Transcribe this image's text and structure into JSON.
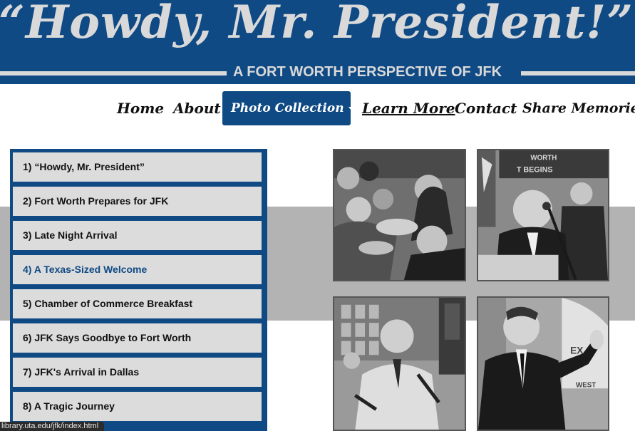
{
  "banner": {
    "title": "“Howdy, Mr. President!”",
    "subtitle": "A FORT WORTH PERSPECTIVE OF JFK"
  },
  "nav": {
    "items": [
      {
        "label": "Home"
      },
      {
        "label": "About"
      },
      {
        "label": "Photo Collection"
      },
      {
        "label": "Learn More"
      },
      {
        "label": "Contact"
      },
      {
        "label": "Share Memories"
      }
    ],
    "active_index": 2
  },
  "chapters": {
    "items": [
      {
        "label": "1) “Howdy, Mr. President”"
      },
      {
        "label": "2) Fort Worth Prepares for JFK"
      },
      {
        "label": "3) Late Night Arrival"
      },
      {
        "label": "4) A Texas-Sized Welcome"
      },
      {
        "label": "5) Chamber of Commerce Breakfast"
      },
      {
        "label": "6) JFK Says Goodbye to Fort Worth"
      },
      {
        "label": "7) JFK's Arrival in Dallas"
      },
      {
        "label": "8) A Tragic Journey"
      }
    ],
    "current_index": 3
  },
  "photos": {
    "sign_top": "WORTH",
    "sign_bottom": "T BEGINS",
    "sign_corner_a": "EX",
    "sign_corner_b": "WEST"
  },
  "status": {
    "url": "library.uta.edu/jfk/index.html"
  },
  "colors": {
    "brand_blue": "#0f4a84",
    "banner_text": "#d9d9d9",
    "list_bg": "#dcdcdc",
    "band_gray": "#b3b3b3"
  }
}
